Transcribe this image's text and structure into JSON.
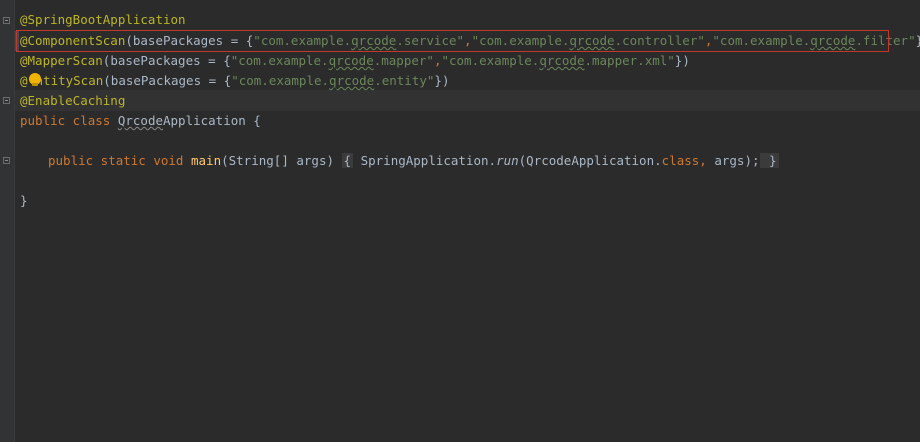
{
  "editor": {
    "lines": {
      "l1": {
        "ann": "@SpringBootApplication"
      },
      "l2": {
        "ann": "@ComponentScan",
        "pre": "(basePackages = {",
        "s1a": "\"com.example.",
        "s1b": "qrcode",
        "s1c": ".service\"",
        "c1": ",",
        "s2a": "\"com.example.",
        "s2b": "qrcode",
        "s2c": ".controller\"",
        "c2": ",",
        "s3a": "\"com.example.",
        "s3b": "qrcode",
        "s3c": ".filter\"",
        "post": "})"
      },
      "l3": {
        "ann": "@MapperScan",
        "pre": "(basePackages = {",
        "s1a": "\"com.example.",
        "s1b": "qrcode",
        "s1c": ".mapper\"",
        "c1": ",",
        "s2a": "\"com.example.",
        "s2b": "qrcode",
        "s2c": ".mapper.xml\"",
        "post": "})"
      },
      "l4": {
        "ann_a": "@",
        "ann_b": "ntityScan",
        "pre": "(basePackages = {",
        "s1a": "\"com.example.",
        "s1b": "qrcode",
        "s1c": ".entity\"",
        "post": "})"
      },
      "l5": {
        "ann": "@EnableCaching"
      },
      "l6": {
        "kw": "public class ",
        "name": "Qrcode",
        "rest": "Application {"
      },
      "l8": {
        "kw1": "public static void ",
        "fn": "main",
        "args": "(String[] args) ",
        "ob": "{",
        "body1": " SpringApplication.",
        "run": "run",
        "body2": "(QrcodeApplication.",
        "cls": "class",
        "comma": ", ",
        "args2": "args);",
        "cb": " }"
      },
      "l10": {
        "text": "}"
      }
    }
  }
}
